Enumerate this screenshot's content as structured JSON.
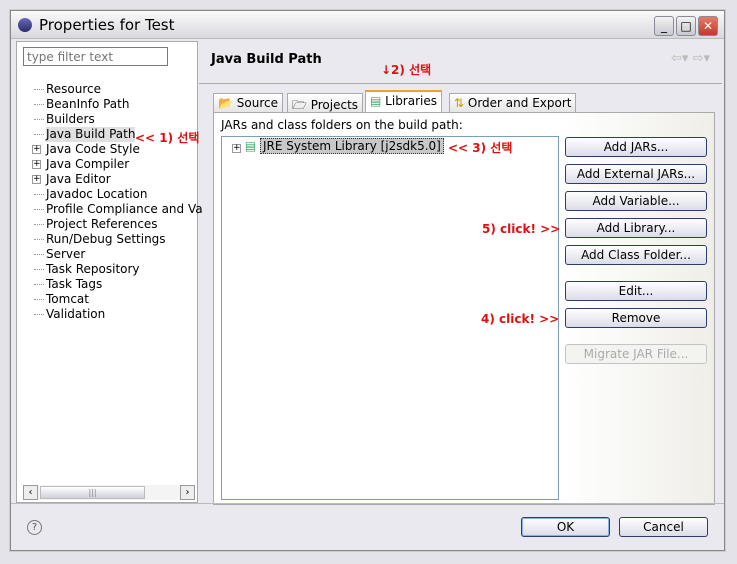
{
  "window": {
    "title": "Properties for Test"
  },
  "filter": {
    "placeholder": "type filter text"
  },
  "tree": [
    {
      "label": "Resource",
      "expandable": false
    },
    {
      "label": "BeanInfo Path",
      "expandable": false
    },
    {
      "label": "Builders",
      "expandable": false
    },
    {
      "label": "Java Build Path",
      "expandable": false,
      "selected": true
    },
    {
      "label": "Java Code Style",
      "expandable": true
    },
    {
      "label": "Java Compiler",
      "expandable": true
    },
    {
      "label": "Java Editor",
      "expandable": true
    },
    {
      "label": "Javadoc Location",
      "expandable": false
    },
    {
      "label": "Profile Compliance and Va",
      "expandable": false
    },
    {
      "label": "Project References",
      "expandable": false
    },
    {
      "label": "Run/Debug Settings",
      "expandable": false
    },
    {
      "label": "Server",
      "expandable": false
    },
    {
      "label": "Task Repository",
      "expandable": false
    },
    {
      "label": "Task Tags",
      "expandable": false
    },
    {
      "label": "Tomcat",
      "expandable": false
    },
    {
      "label": "Validation",
      "expandable": false
    }
  ],
  "page": {
    "title": "Java Build Path"
  },
  "tabs": [
    {
      "label": "Source",
      "icon": "source-folder-icon"
    },
    {
      "label": "Projects",
      "icon": "folder-icon"
    },
    {
      "label": "Libraries",
      "icon": "library-icon",
      "active": true
    },
    {
      "label": "Order and Export",
      "icon": "order-icon"
    }
  ],
  "content": {
    "label": "JARs and class folders on the build path:",
    "entries": [
      "JRE System Library [j2sdk5.0]"
    ]
  },
  "buttons": [
    "Add JARs...",
    "Add External JARs...",
    "Add Variable...",
    "Add Library...",
    "Add Class Folder...",
    "Edit...",
    "Remove",
    "Migrate JAR File..."
  ],
  "annotations": {
    "a1": "<< 1) 선택",
    "a2": "↓2) 선택",
    "a3": "<< 3) 선택",
    "a4": "4) click! >>",
    "a5": "5) click! >>"
  },
  "footer": {
    "ok": "OK",
    "cancel": "Cancel",
    "help": "?"
  },
  "colors": {
    "annotation": "#e01010",
    "tab_highlight": "#f0a030"
  }
}
